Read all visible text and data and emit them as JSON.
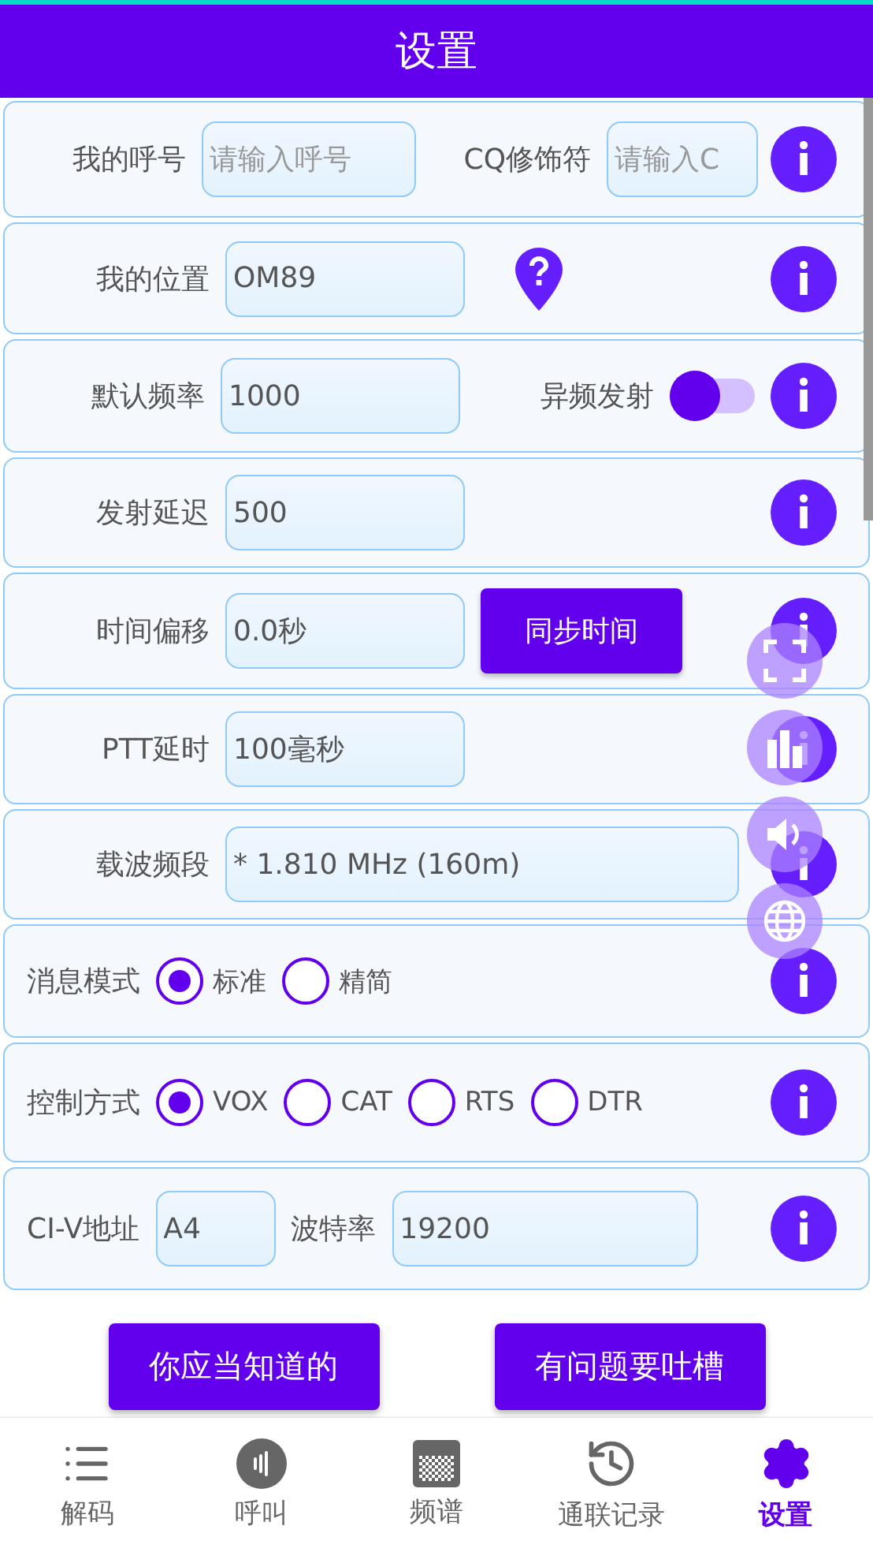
{
  "header": {
    "title": "设置"
  },
  "rows": [
    {
      "kind": "form",
      "items": [
        {
          "kind": "label",
          "text": "我的呼号"
        },
        {
          "kind": "field",
          "placeholder": "请输入呼号"
        },
        {
          "kind": "label",
          "text": "CQ修饰符"
        },
        {
          "kind": "field",
          "placeholder": "请输入C"
        }
      ]
    },
    {
      "kind": "form",
      "items": [
        {
          "kind": "label",
          "text": "我的位置"
        },
        {
          "kind": "field",
          "value": "OM89"
        },
        {
          "kind": "pin"
        }
      ]
    },
    {
      "kind": "form",
      "items": [
        {
          "kind": "label",
          "text": "默认频率"
        },
        {
          "kind": "field",
          "value": "1000"
        },
        {
          "kind": "label",
          "text": "异频发射"
        },
        {
          "kind": "switch",
          "on": false
        }
      ]
    },
    {
      "kind": "form",
      "items": [
        {
          "kind": "label",
          "text": "发射延迟"
        },
        {
          "kind": "field",
          "value": "500"
        }
      ]
    },
    {
      "kind": "form",
      "items": [
        {
          "kind": "label",
          "text": "时间偏移"
        },
        {
          "kind": "field",
          "value": "0.0秒"
        },
        {
          "kind": "button",
          "text": "同步时间"
        }
      ]
    },
    {
      "kind": "form",
      "items": [
        {
          "kind": "label",
          "text": "PTT延时"
        },
        {
          "kind": "field",
          "value": "100毫秒"
        }
      ]
    },
    {
      "kind": "form",
      "items": [
        {
          "kind": "label",
          "text": "载波频段"
        },
        {
          "kind": "field",
          "value": "* 1.810 MHz (160m)"
        }
      ]
    },
    {
      "kind": "choice",
      "items": [
        {
          "kind": "label",
          "text": "消息模式"
        },
        {
          "kind": "radio",
          "text": "标准",
          "selected": true
        },
        {
          "kind": "radio",
          "text": "精简",
          "selected": false
        }
      ]
    },
    {
      "kind": "choice",
      "items": [
        {
          "kind": "label",
          "text": "控制方式"
        },
        {
          "kind": "radio",
          "text": "VOX",
          "selected": true
        },
        {
          "kind": "radio",
          "text": "CAT",
          "selected": false
        },
        {
          "kind": "radio",
          "text": "RTS",
          "selected": false
        },
        {
          "kind": "radio",
          "text": "DTR",
          "selected": false
        }
      ]
    },
    {
      "kind": "choice",
      "items": [
        {
          "kind": "label",
          "text": "CI-V地址"
        },
        {
          "kind": "field",
          "value": "A4"
        },
        {
          "kind": "label",
          "text": "波特率"
        },
        {
          "kind": "field",
          "value": "19200"
        }
      ]
    }
  ],
  "actions": [
    "你应当知道的",
    "有问题要吐槽"
  ],
  "nav": [
    {
      "label": "解码",
      "selected": false
    },
    {
      "label": "呼叫",
      "selected": false
    },
    {
      "label": "频谱",
      "selected": false
    },
    {
      "label": "通联记录",
      "selected": false
    },
    {
      "label": "设置",
      "selected": true
    }
  ]
}
